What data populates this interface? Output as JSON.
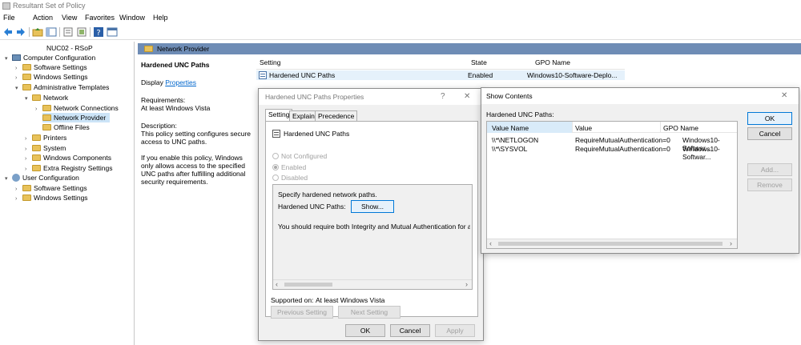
{
  "window": {
    "title": "Resultant Set of Policy"
  },
  "menu": [
    "File",
    "Action",
    "View",
    "Favorites",
    "Window",
    "Help"
  ],
  "tree": {
    "root": "NUC02 - RSoP",
    "computer": "Computer Configuration",
    "software": "Software Settings",
    "windows": "Windows Settings",
    "admin": "Administrative Templates",
    "network": "Network",
    "netconn": "Network Connections",
    "netprov": "Network Provider",
    "offline": "Offline Files",
    "printers": "Printers",
    "system": "System",
    "wincomp": "Windows Components",
    "extra": "Extra Registry Settings",
    "user": "User Configuration",
    "usoftware": "Software Settings",
    "uwindows": "Windows Settings"
  },
  "panel": {
    "header": "Network Provider",
    "title": "Hardened UNC Paths",
    "display_prefix": "Display ",
    "display_link": "Properties",
    "req_label": "Requirements:",
    "req_value": "At least Windows Vista",
    "desc_label": "Description:",
    "desc1": "This policy setting configures secure access to UNC paths.",
    "desc2": "If you enable this policy, Windows only allows access to the specified UNC paths after fulfilling additional security requirements."
  },
  "list": {
    "col_setting": "Setting",
    "col_state": "State",
    "col_gpo": "GPO Name",
    "row_setting": "Hardened UNC Paths",
    "row_state": "Enabled",
    "row_gpo": "Windows10-Software-Deplo..."
  },
  "props": {
    "title": "Hardened UNC Paths Properties",
    "help": "?",
    "close": "✕",
    "tabs": [
      "Setting",
      "Explain",
      "Precedence"
    ],
    "policy_name": "Hardened UNC Paths",
    "opt_nc": "Not Configured",
    "opt_en": "Enabled",
    "opt_dis": "Disabled",
    "box_line1": "Specify hardened network paths.",
    "box_label": "Hardened UNC Paths:",
    "show_btn": "Show...",
    "box_line2": "You should require both Integrity and Mutual Authentication for any UNC p",
    "supported_label": "Supported on:",
    "supported_value": "At least Windows Vista",
    "prev_btn": "Previous Setting",
    "next_btn": "Next Setting",
    "ok": "OK",
    "cancel": "Cancel",
    "apply": "Apply"
  },
  "show": {
    "title": "Show Contents",
    "close": "✕",
    "label": "Hardened UNC Paths:",
    "col_name": "Value Name",
    "col_value": "Value",
    "col_gpo": "GPO Name",
    "rows": [
      {
        "name": "\\\\*\\NETLOGON",
        "value": "RequireMutualAuthentication=0",
        "gpo": "Windows10-Softwar..."
      },
      {
        "name": "\\\\*\\SYSVOL",
        "value": "RequireMutualAuthentication=0",
        "gpo": "Windows10-Softwar..."
      }
    ],
    "ok": "OK",
    "cancel": "Cancel",
    "add": "Add...",
    "remove": "Remove"
  }
}
